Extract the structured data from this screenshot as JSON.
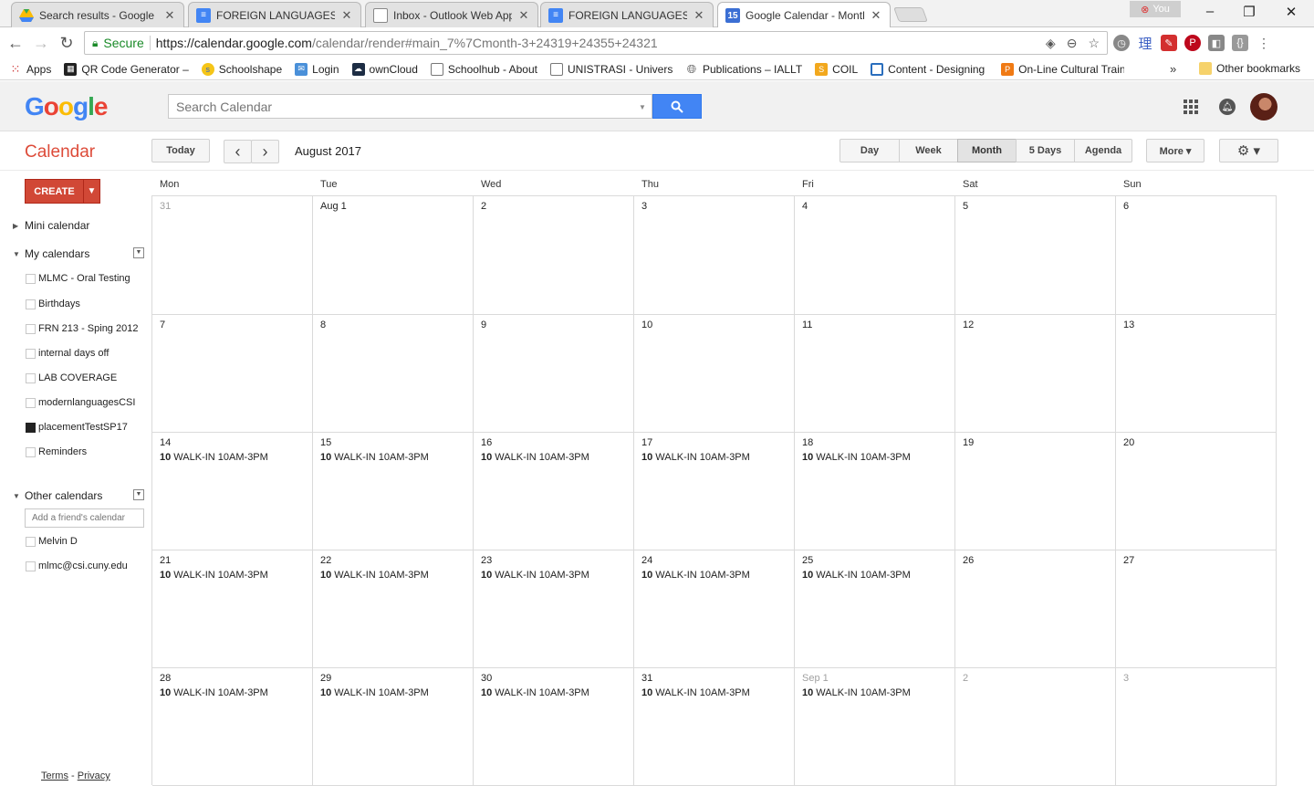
{
  "browser": {
    "tabs": [
      {
        "title": "Search results - Google D",
        "icon": "drive-icon",
        "active": false
      },
      {
        "title": "FOREIGN LANGUAGES PL",
        "icon": "docs-icon",
        "active": false
      },
      {
        "title": "Inbox - Outlook Web App",
        "icon": "page-icon",
        "active": false
      },
      {
        "title": "FOREIGN LANGUAGES PL",
        "icon": "docs-icon",
        "active": false
      },
      {
        "title": "Google Calendar - Month",
        "icon": "calendar-icon",
        "active": true
      }
    ],
    "profile_label": "You",
    "secure_label": "Secure",
    "url_scheme_host": "https://calendar.google.com",
    "url_path": "/calendar/render#main_7%7Cmonth-3+24319+24355+24321",
    "bookmarks": [
      {
        "label": "Apps",
        "icon": "apps-grid-icon"
      },
      {
        "label": "QR Code Generator –",
        "icon": "qr-icon"
      },
      {
        "label": "Schoolshape",
        "icon": "schoolshape-icon"
      },
      {
        "label": "Login",
        "icon": "mail-icon"
      },
      {
        "label": "ownCloud",
        "icon": "cloud-icon"
      },
      {
        "label": "Schoolhub - About",
        "icon": "page-icon"
      },
      {
        "label": "UNISTRASI - Universit",
        "icon": "page-icon"
      },
      {
        "label": "Publications – IALLT",
        "icon": "globe-icon"
      },
      {
        "label": "COIL",
        "icon": "coil-icon"
      },
      {
        "label": "Content - Designing I",
        "icon": "content-icon"
      },
      {
        "label": "On-Line Cultural Train",
        "icon": "p-icon"
      }
    ],
    "bookmarks_more": "»",
    "other_bookmarks": "Other bookmarks"
  },
  "header": {
    "logo_letters": [
      "G",
      "o",
      "o",
      "g",
      "l",
      "e"
    ],
    "search_placeholder": "Search Calendar"
  },
  "toolbar": {
    "app_title": "Calendar",
    "today_label": "Today",
    "prev_label": "‹",
    "next_label": "›",
    "current_range": "August 2017",
    "views": [
      {
        "label": "Day",
        "selected": false
      },
      {
        "label": "Week",
        "selected": false
      },
      {
        "label": "Month",
        "selected": true
      },
      {
        "label": "5 Days",
        "selected": false
      },
      {
        "label": "Agenda",
        "selected": false
      }
    ],
    "more_label": "More ▾",
    "settings_label": "⚙ ▾"
  },
  "sidebar": {
    "create_label": "CREATE",
    "create_arrow": "▼",
    "mini_calendar_label": "Mini calendar",
    "my_calendars_label": "My calendars",
    "my_calendars": [
      {
        "name": "MLMC - Oral Testing",
        "checked": false
      },
      {
        "name": "Birthdays",
        "checked": false
      },
      {
        "name": "FRN 213 - Sping 2012",
        "checked": false
      },
      {
        "name": "internal days off",
        "checked": false
      },
      {
        "name": "LAB COVERAGE",
        "checked": false
      },
      {
        "name": "modernlanguagesCSI",
        "checked": false
      },
      {
        "name": "placementTestSP17",
        "checked": true
      },
      {
        "name": "Reminders",
        "checked": false
      }
    ],
    "other_calendars_label": "Other calendars",
    "friend_placeholder": "Add a friend's calendar",
    "other_calendars": [
      {
        "name": "Melvin D",
        "checked": false
      },
      {
        "name": "mlmc@csi.cuny.edu",
        "checked": false
      }
    ],
    "terms_label": "Terms",
    "terms_sep": " - ",
    "privacy_label": "Privacy"
  },
  "month": {
    "weekdays": [
      "Mon",
      "Tue",
      "Wed",
      "Thu",
      "Fri",
      "Sat",
      "Sun"
    ],
    "event_time": "10",
    "event_title": " WALK-IN 10AM-3PM",
    "weeks": [
      [
        {
          "label": "31",
          "other": true,
          "event": false
        },
        {
          "label": "Aug 1",
          "other": false,
          "event": false
        },
        {
          "label": "2",
          "other": false,
          "event": false
        },
        {
          "label": "3",
          "other": false,
          "event": false
        },
        {
          "label": "4",
          "other": false,
          "event": false
        },
        {
          "label": "5",
          "other": false,
          "event": false
        },
        {
          "label": "6",
          "other": false,
          "event": false
        }
      ],
      [
        {
          "label": "7",
          "other": false,
          "event": false
        },
        {
          "label": "8",
          "other": false,
          "event": false
        },
        {
          "label": "9",
          "other": false,
          "event": false
        },
        {
          "label": "10",
          "other": false,
          "event": false
        },
        {
          "label": "11",
          "other": false,
          "event": false
        },
        {
          "label": "12",
          "other": false,
          "event": false
        },
        {
          "label": "13",
          "other": false,
          "event": false
        }
      ],
      [
        {
          "label": "14",
          "other": false,
          "event": true
        },
        {
          "label": "15",
          "other": false,
          "event": true
        },
        {
          "label": "16",
          "other": false,
          "event": true
        },
        {
          "label": "17",
          "other": false,
          "event": true
        },
        {
          "label": "18",
          "other": false,
          "event": true
        },
        {
          "label": "19",
          "other": false,
          "event": false
        },
        {
          "label": "20",
          "other": false,
          "event": false
        }
      ],
      [
        {
          "label": "21",
          "other": false,
          "event": true
        },
        {
          "label": "22",
          "other": false,
          "event": true
        },
        {
          "label": "23",
          "other": false,
          "event": true
        },
        {
          "label": "24",
          "other": false,
          "event": true
        },
        {
          "label": "25",
          "other": false,
          "event": true
        },
        {
          "label": "26",
          "other": false,
          "event": false
        },
        {
          "label": "27",
          "other": false,
          "event": false
        }
      ],
      [
        {
          "label": "28",
          "other": false,
          "event": true
        },
        {
          "label": "29",
          "other": false,
          "event": true
        },
        {
          "label": "30",
          "other": false,
          "event": true
        },
        {
          "label": "31",
          "other": false,
          "event": true
        },
        {
          "label": "Sep 1",
          "other": true,
          "event": true
        },
        {
          "label": "2",
          "other": true,
          "event": false
        },
        {
          "label": "3",
          "other": true,
          "event": false
        }
      ]
    ]
  },
  "colors": {
    "brand_red": "#dd4b39",
    "create_red": "#d14836",
    "search_blue": "#4285f4",
    "secure_green": "#1a8a28"
  }
}
